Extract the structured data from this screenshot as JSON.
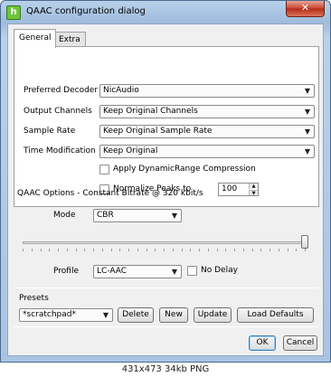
{
  "window": {
    "title": "QAAC configuration dialog",
    "icon_letter": "h",
    "close_label": "✕"
  },
  "tabs": [
    {
      "label": "General",
      "active": true
    },
    {
      "label": "Extra",
      "active": false
    }
  ],
  "general": {
    "decoder": {
      "label": "Preferred Decoder",
      "value": "NicAudio"
    },
    "channels": {
      "label": "Output Channels",
      "value": "Keep Original Channels"
    },
    "sample_rate": {
      "label": "Sample Rate",
      "value": "Keep Original Sample Rate"
    },
    "time_mod": {
      "label": "Time Modification",
      "value": "Keep Original"
    },
    "drc": {
      "label": "Apply DynamicRange Compression",
      "checked": false
    },
    "normalize": {
      "label": "Normalize Peaks to",
      "checked": false,
      "value": "100"
    }
  },
  "options": {
    "header": "QAAC Options - Constant Bitrate  @ 320 kbit/s",
    "mode_label": "Mode",
    "mode_value": "CBR",
    "bitrate_fraction": 1.0,
    "profile_label": "Profile",
    "profile_value": "LC-AAC",
    "no_delay_label": "No Delay",
    "no_delay_checked": false
  },
  "presets": {
    "label": "Presets",
    "current": "*scratchpad*",
    "delete": "Delete",
    "new": "New",
    "update": "Update",
    "load_defaults": "Load Defaults"
  },
  "dialog": {
    "ok": "OK",
    "cancel": "Cancel"
  },
  "statusbar": {
    "text": "431x473  34kb  PNG"
  },
  "colors": {
    "titlebar": "#b9d1ea",
    "close": "#c7442f",
    "default_button_border": "#3c7fb1"
  }
}
